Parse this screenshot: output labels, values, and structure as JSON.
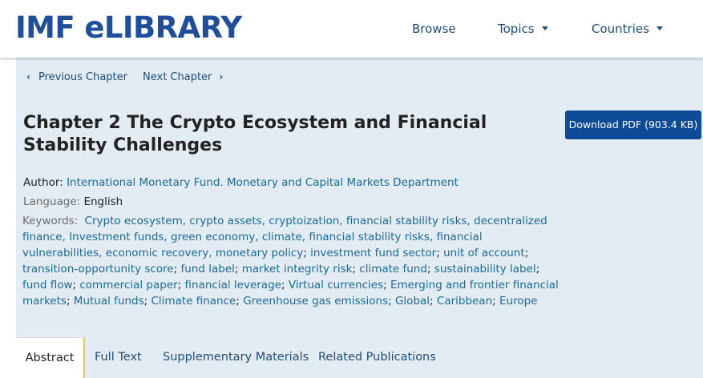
{
  "header": {
    "logo": "IMF eLIBRARY",
    "nav": {
      "browse": "Browse",
      "topics": "Topics",
      "countries": "Countries"
    }
  },
  "chapter_nav": {
    "previous": "Previous Chapter",
    "next": "Next Chapter"
  },
  "title": "Chapter 2 The Crypto Ecosystem and Financial Stability Challenges",
  "download_button": "Download PDF (903.4 KB)",
  "author": {
    "label": "Author:",
    "value": "International Monetary Fund. Monetary and Capital Markets Department"
  },
  "language": {
    "label": "Language:",
    "value": "English"
  },
  "keywords": {
    "label": "Keywords:",
    "items": [
      "Crypto ecosystem, crypto assets, cryptoization, financial stability risks, decentralized finance, Investment funds, green economy, climate, financial stability risks, financial vulnerabilities, economic recovery, monetary policy",
      "investment fund sector",
      "unit of account",
      "transition-opportunity score",
      "fund label",
      "market integrity risk",
      "climate fund",
      "sustainability label",
      "fund flow",
      "commercial paper",
      "financial leverage",
      "Virtual currencies",
      "Emerging and frontier financial markets",
      "Mutual funds",
      "Climate finance",
      "Greenhouse gas emissions",
      "Global",
      "Caribbean",
      "Europe"
    ]
  },
  "tabs": {
    "abstract": "Abstract",
    "full_text": "Full Text",
    "supplementary": "Supplementary Materials",
    "related": "Related Publications"
  },
  "colors": {
    "logo": "#1f4e9c",
    "link": "#1b6a95",
    "button": "#0e4b96",
    "panel": "#e3ebf3",
    "active_tab_accent": "#e8c44a"
  }
}
